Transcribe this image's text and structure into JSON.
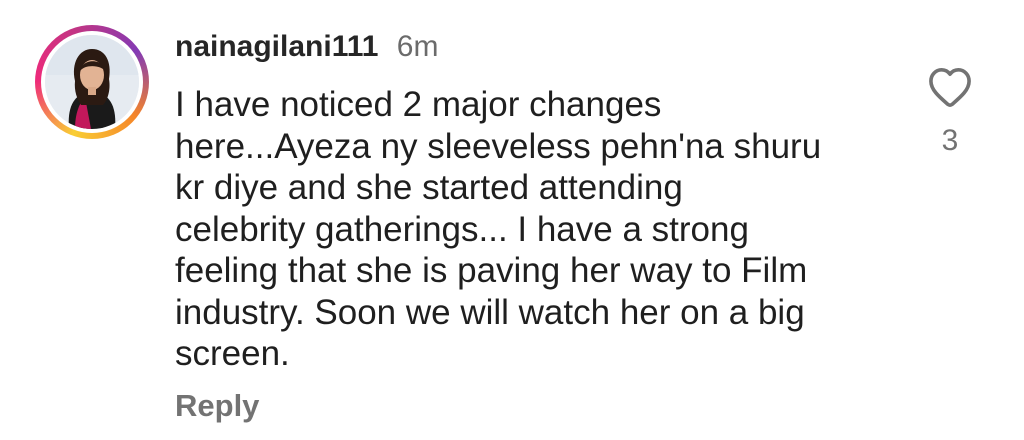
{
  "comment": {
    "username": "nainagilani111",
    "timestamp": "6m",
    "text": "I have noticed 2 major changes\nhere...Ayeza ny sleeveless pehn'na shuru\nkr diye and she started attending\ncelebrity gatherings... I have a strong\nfeeling that she is paving her way to Film\nindustry. Soon we will watch her on a big\nscreen.",
    "reply_label": "Reply",
    "like_count": "3",
    "icons": {
      "like": "heart-outline-icon",
      "avatar": "profile-photo"
    },
    "colors": {
      "story_ring_start": "#f9ce34",
      "story_ring_mid": "#ee2a7b",
      "story_ring_end": "#833ab4",
      "muted_text": "#737373"
    }
  }
}
